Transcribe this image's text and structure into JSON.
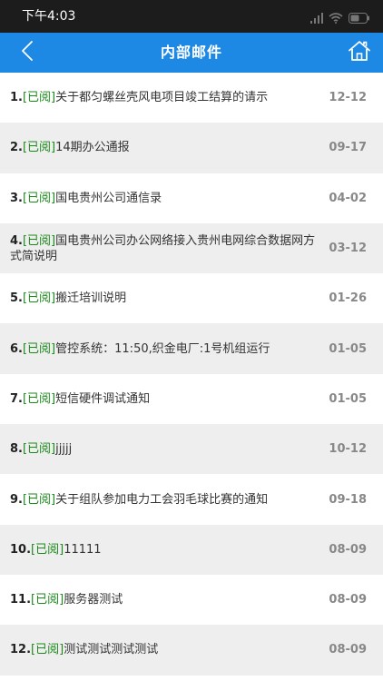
{
  "status_bar": {
    "time": "下午4:03",
    "icons": [
      "signal-icon",
      "wifi-icon",
      "battery-icon"
    ]
  },
  "nav": {
    "title": "内部邮件",
    "back_icon": "chevron-left-icon",
    "home_icon": "home-icon"
  },
  "colors": {
    "nav_background": "#1e88e5",
    "status_bar_background": "#1c1c1c",
    "read_status": "#1b8a1b",
    "date_text": "#888888",
    "row_alt_background": "#eeeeee"
  },
  "mails": [
    {
      "index": "1.",
      "status": "[已阅]",
      "subject": "关于都匀螺丝壳风电项目竣工结算的请示",
      "date": "12-12"
    },
    {
      "index": "2.",
      "status": "[已阅]",
      "subject": "14期办公通报",
      "date": "09-17"
    },
    {
      "index": "3.",
      "status": "[已阅]",
      "subject": "国电贵州公司通信录",
      "date": "04-02"
    },
    {
      "index": "4.",
      "status": "[已阅]",
      "subject": "国电贵州公司办公网络接入贵州电网综合数据网方式简说明",
      "date": "03-12"
    },
    {
      "index": "5.",
      "status": "[已阅]",
      "subject": "搬迁培训说明",
      "date": "01-26"
    },
    {
      "index": "6.",
      "status": "[已阅]",
      "subject": "管控系统：11:50,织金电厂:1号机组运行",
      "date": "01-05"
    },
    {
      "index": "7.",
      "status": "[已阅]",
      "subject": "短信硬件调试通知",
      "date": "01-05"
    },
    {
      "index": "8.",
      "status": "[已阅]",
      "subject": "jjjjj",
      "date": "10-12"
    },
    {
      "index": "9.",
      "status": "[已阅]",
      "subject": "关于组队参加电力工会羽毛球比赛的通知",
      "date": "09-18"
    },
    {
      "index": "10.",
      "status": "[已阅]",
      "subject": "11111",
      "date": "08-09"
    },
    {
      "index": "11.",
      "status": "[已阅]",
      "subject": "服务器测试",
      "date": "08-09"
    },
    {
      "index": "12.",
      "status": "[已阅]",
      "subject": "测试测试测试测试",
      "date": "08-09"
    }
  ]
}
